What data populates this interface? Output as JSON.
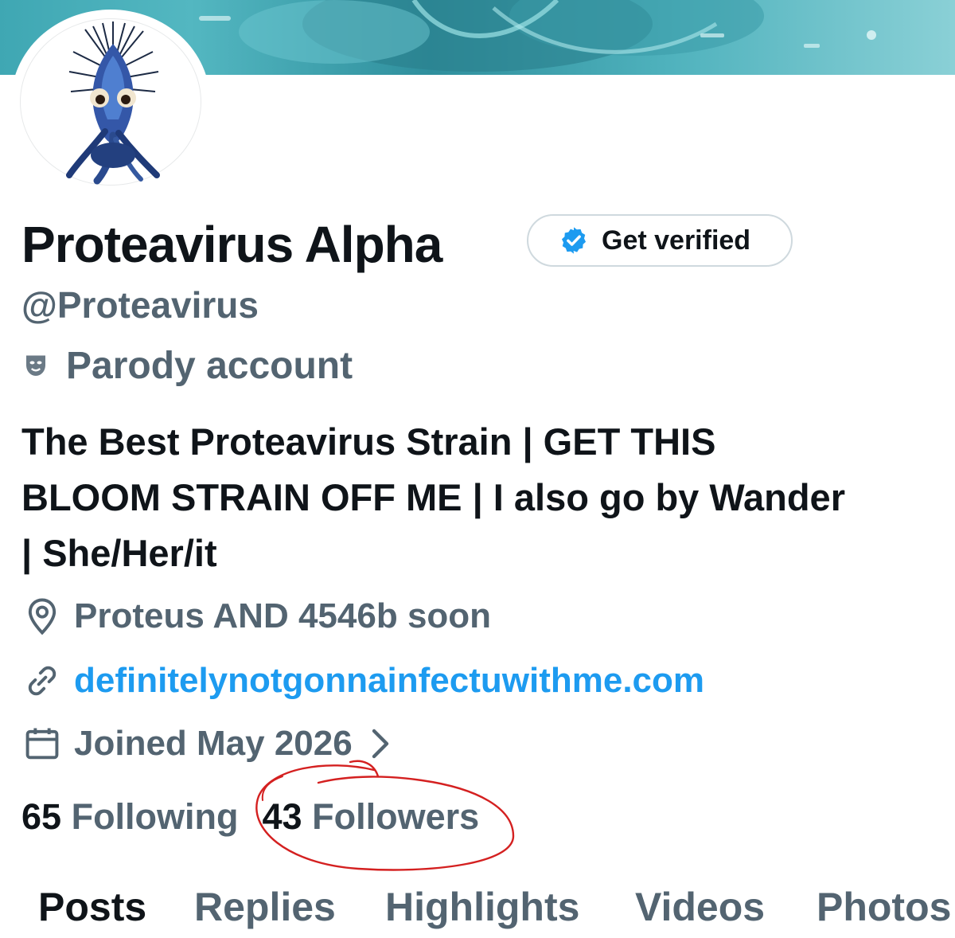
{
  "profile": {
    "display_name": "Proteavirus Alpha",
    "handle": "@Proteavirus",
    "parody_label": "Parody account",
    "bio_lines": [
      "The Best Proteavirus Strain | GET THIS",
      "BLOOM STRAIN OFF ME | I also go by Wander",
      "| She/Her/it"
    ],
    "location": "Proteus AND 4546b soon",
    "website": "definitelynotgonnainfectuwithme.com",
    "joined": "Joined May 2026"
  },
  "verify_button": {
    "label": "Get verified"
  },
  "stats": {
    "following_count": "65",
    "following_label": "Following",
    "followers_count": "43",
    "followers_label": "Followers"
  },
  "tabs": [
    "Posts",
    "Replies",
    "Highlights",
    "Videos",
    "Photos"
  ],
  "active_tab": "Posts",
  "colors": {
    "text_primary": "#0f1419",
    "text_secondary": "#536471",
    "link": "#1d9bf0",
    "annotation": "#d42020",
    "banner": "#3fa7b3"
  },
  "icons": {
    "verify_badge": "verified-badge-icon",
    "parody": "theater-mask-icon",
    "location": "map-pin-icon",
    "website": "link-icon",
    "joined": "calendar-icon",
    "joined_more": "chevron-right-icon"
  }
}
